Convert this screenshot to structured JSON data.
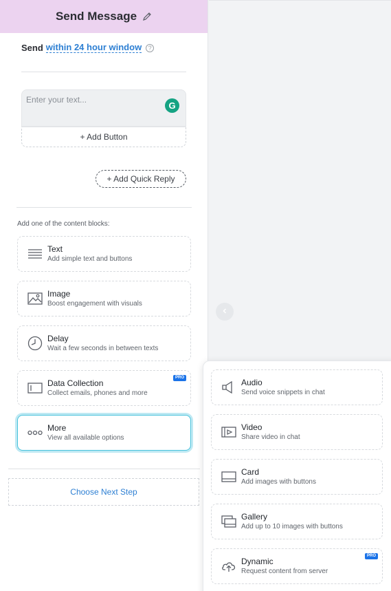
{
  "header": {
    "title": "Send Message",
    "edit_icon": "pencil-icon"
  },
  "send_row": {
    "label": "Send",
    "link": "within 24 hour window",
    "help_icon": "question-circle-icon",
    "help_glyph": "?"
  },
  "message": {
    "placeholder": "Enter your text...",
    "grammarly_icon": "grammarly-icon",
    "grammarly_glyph": "G",
    "add_button_label": "+ Add Button"
  },
  "quick_reply_label": "+ Add Quick Reply",
  "blocks_section": {
    "label": "Add one of the content blocks:",
    "items": [
      {
        "title": "Text",
        "desc": "Add simple text and buttons",
        "icon": "text-lines-icon"
      },
      {
        "title": "Image",
        "desc": "Boost engagement with visuals",
        "icon": "image-icon"
      },
      {
        "title": "Delay",
        "desc": "Wait a few seconds in between texts",
        "icon": "clock-icon"
      },
      {
        "title": "Data Collection",
        "desc": "Collect emails, phones and more",
        "icon": "form-field-icon",
        "badge": "PRO"
      },
      {
        "title": "More",
        "desc": "View all available options",
        "icon": "more-dots-icon"
      }
    ]
  },
  "next_step_label": "Choose Next Step",
  "more_menu": {
    "items": [
      {
        "title": "Audio",
        "desc": "Send voice snippets in chat",
        "icon": "speaker-icon"
      },
      {
        "title": "Video",
        "desc": "Share video in chat",
        "icon": "video-icon"
      },
      {
        "title": "Card",
        "desc": "Add images with buttons",
        "icon": "card-icon"
      },
      {
        "title": "Gallery",
        "desc": "Add up to 10 images with buttons",
        "icon": "gallery-icon"
      },
      {
        "title": "Dynamic",
        "desc": "Request content from server",
        "icon": "cloud-upload-icon",
        "badge": "PRO"
      }
    ]
  },
  "colors": {
    "header_bg": "#ecd3f0",
    "link": "#2d7fd3",
    "pro_badge": "#1b73e8",
    "selected_outline": "#47c2dc"
  }
}
